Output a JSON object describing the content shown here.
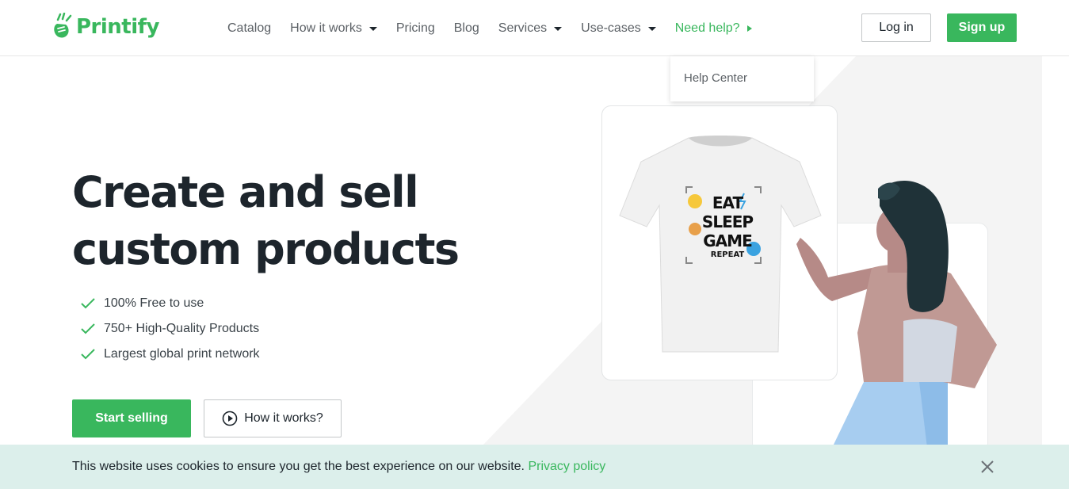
{
  "brand": {
    "name": "Printify",
    "accent": "#39b75d"
  },
  "nav": {
    "items": [
      {
        "label": "Catalog",
        "has_caret": false
      },
      {
        "label": "How it works",
        "has_caret": true
      },
      {
        "label": "Pricing",
        "has_caret": false
      },
      {
        "label": "Blog",
        "has_caret": false
      },
      {
        "label": "Services",
        "has_caret": true
      },
      {
        "label": "Use-cases",
        "has_caret": true
      }
    ],
    "help": {
      "label": "Need help?",
      "icon": "caret-right-icon"
    },
    "login_label": "Log in",
    "signup_label": "Sign up"
  },
  "dropdown": {
    "items": [
      "Help Center"
    ]
  },
  "hero": {
    "title_line1": "Create and sell",
    "title_line2": "custom products",
    "features": [
      "100% Free to use",
      "750+ High-Quality Products",
      "Largest global print network"
    ],
    "start_label": "Start selling",
    "how_label": "How it works?"
  },
  "product": {
    "print_lines": [
      "EAT",
      "SLEEP",
      "GAME",
      "REPEAT"
    ]
  },
  "cookie": {
    "text": "This website uses cookies to ensure you get the best experience on our website.",
    "link_label": "Privacy policy"
  }
}
